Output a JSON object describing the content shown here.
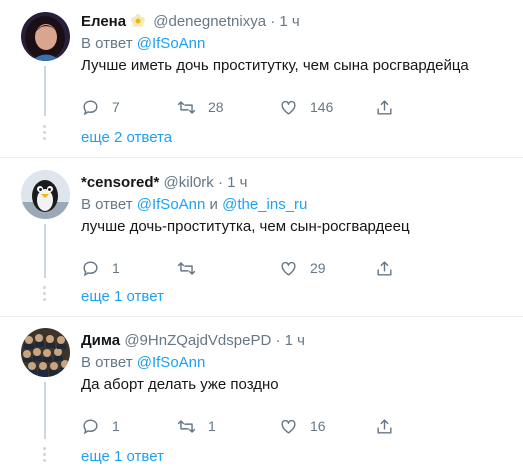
{
  "tweets": [
    {
      "name": "Елена",
      "handle": "@denegnetnixya",
      "sep": "·",
      "time": "1 ч",
      "reply_prefix": "В ответ",
      "mentions": [
        "@IfSoAnn"
      ],
      "text": "Лучше иметь дочь проститутку, чем сына росгвардейца",
      "replies": "7",
      "retweets": "28",
      "likes": "146",
      "more": "еще 2 ответа"
    },
    {
      "name": "*censored*",
      "handle": "@kil0rk",
      "sep": "·",
      "time": "1 ч",
      "reply_prefix": "В ответ",
      "mentions": [
        "@IfSoAnn",
        "@the_ins_ru"
      ],
      "conj": "и",
      "text": "лучше дочь-проститутка, чем сын-росгвардеец",
      "replies": "1",
      "retweets": "",
      "likes": "29",
      "more": "еще 1 ответ"
    },
    {
      "name": "Дима",
      "handle": "@9HnZQajdVdspePD",
      "sep": "·",
      "time": "1 ч",
      "reply_prefix": "В ответ",
      "mentions": [
        "@IfSoAnn"
      ],
      "text": "Да аборт делать уже поздно",
      "replies": "1",
      "retweets": "1",
      "likes": "16",
      "more": "еще 1 ответ"
    }
  ],
  "colors": {
    "accent": "#1da1f2",
    "secondary": "#657786",
    "text": "#14171a",
    "line": "#ccd6dd"
  },
  "icons": [
    "reply-icon",
    "retweet-icon",
    "like-icon",
    "share-icon",
    "flower-emoji-icon"
  ]
}
